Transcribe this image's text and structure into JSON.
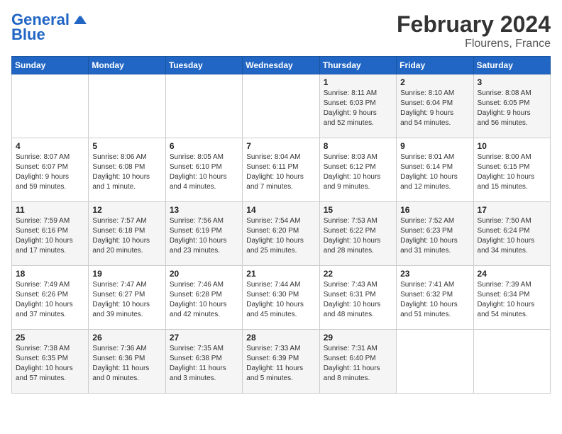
{
  "header": {
    "logo_line1": "General",
    "logo_line2": "Blue",
    "month": "February 2024",
    "location": "Flourens, France"
  },
  "days_of_week": [
    "Sunday",
    "Monday",
    "Tuesday",
    "Wednesday",
    "Thursday",
    "Friday",
    "Saturday"
  ],
  "weeks": [
    [
      {
        "day": "",
        "info": ""
      },
      {
        "day": "",
        "info": ""
      },
      {
        "day": "",
        "info": ""
      },
      {
        "day": "",
        "info": ""
      },
      {
        "day": "1",
        "info": "Sunrise: 8:11 AM\nSunset: 6:03 PM\nDaylight: 9 hours\nand 52 minutes."
      },
      {
        "day": "2",
        "info": "Sunrise: 8:10 AM\nSunset: 6:04 PM\nDaylight: 9 hours\nand 54 minutes."
      },
      {
        "day": "3",
        "info": "Sunrise: 8:08 AM\nSunset: 6:05 PM\nDaylight: 9 hours\nand 56 minutes."
      }
    ],
    [
      {
        "day": "4",
        "info": "Sunrise: 8:07 AM\nSunset: 6:07 PM\nDaylight: 9 hours\nand 59 minutes."
      },
      {
        "day": "5",
        "info": "Sunrise: 8:06 AM\nSunset: 6:08 PM\nDaylight: 10 hours\nand 1 minute."
      },
      {
        "day": "6",
        "info": "Sunrise: 8:05 AM\nSunset: 6:10 PM\nDaylight: 10 hours\nand 4 minutes."
      },
      {
        "day": "7",
        "info": "Sunrise: 8:04 AM\nSunset: 6:11 PM\nDaylight: 10 hours\nand 7 minutes."
      },
      {
        "day": "8",
        "info": "Sunrise: 8:03 AM\nSunset: 6:12 PM\nDaylight: 10 hours\nand 9 minutes."
      },
      {
        "day": "9",
        "info": "Sunrise: 8:01 AM\nSunset: 6:14 PM\nDaylight: 10 hours\nand 12 minutes."
      },
      {
        "day": "10",
        "info": "Sunrise: 8:00 AM\nSunset: 6:15 PM\nDaylight: 10 hours\nand 15 minutes."
      }
    ],
    [
      {
        "day": "11",
        "info": "Sunrise: 7:59 AM\nSunset: 6:16 PM\nDaylight: 10 hours\nand 17 minutes."
      },
      {
        "day": "12",
        "info": "Sunrise: 7:57 AM\nSunset: 6:18 PM\nDaylight: 10 hours\nand 20 minutes."
      },
      {
        "day": "13",
        "info": "Sunrise: 7:56 AM\nSunset: 6:19 PM\nDaylight: 10 hours\nand 23 minutes."
      },
      {
        "day": "14",
        "info": "Sunrise: 7:54 AM\nSunset: 6:20 PM\nDaylight: 10 hours\nand 25 minutes."
      },
      {
        "day": "15",
        "info": "Sunrise: 7:53 AM\nSunset: 6:22 PM\nDaylight: 10 hours\nand 28 minutes."
      },
      {
        "day": "16",
        "info": "Sunrise: 7:52 AM\nSunset: 6:23 PM\nDaylight: 10 hours\nand 31 minutes."
      },
      {
        "day": "17",
        "info": "Sunrise: 7:50 AM\nSunset: 6:24 PM\nDaylight: 10 hours\nand 34 minutes."
      }
    ],
    [
      {
        "day": "18",
        "info": "Sunrise: 7:49 AM\nSunset: 6:26 PM\nDaylight: 10 hours\nand 37 minutes."
      },
      {
        "day": "19",
        "info": "Sunrise: 7:47 AM\nSunset: 6:27 PM\nDaylight: 10 hours\nand 39 minutes."
      },
      {
        "day": "20",
        "info": "Sunrise: 7:46 AM\nSunset: 6:28 PM\nDaylight: 10 hours\nand 42 minutes."
      },
      {
        "day": "21",
        "info": "Sunrise: 7:44 AM\nSunset: 6:30 PM\nDaylight: 10 hours\nand 45 minutes."
      },
      {
        "day": "22",
        "info": "Sunrise: 7:43 AM\nSunset: 6:31 PM\nDaylight: 10 hours\nand 48 minutes."
      },
      {
        "day": "23",
        "info": "Sunrise: 7:41 AM\nSunset: 6:32 PM\nDaylight: 10 hours\nand 51 minutes."
      },
      {
        "day": "24",
        "info": "Sunrise: 7:39 AM\nSunset: 6:34 PM\nDaylight: 10 hours\nand 54 minutes."
      }
    ],
    [
      {
        "day": "25",
        "info": "Sunrise: 7:38 AM\nSunset: 6:35 PM\nDaylight: 10 hours\nand 57 minutes."
      },
      {
        "day": "26",
        "info": "Sunrise: 7:36 AM\nSunset: 6:36 PM\nDaylight: 11 hours\nand 0 minutes."
      },
      {
        "day": "27",
        "info": "Sunrise: 7:35 AM\nSunset: 6:38 PM\nDaylight: 11 hours\nand 3 minutes."
      },
      {
        "day": "28",
        "info": "Sunrise: 7:33 AM\nSunset: 6:39 PM\nDaylight: 11 hours\nand 5 minutes."
      },
      {
        "day": "29",
        "info": "Sunrise: 7:31 AM\nSunset: 6:40 PM\nDaylight: 11 hours\nand 8 minutes."
      },
      {
        "day": "",
        "info": ""
      },
      {
        "day": "",
        "info": ""
      }
    ]
  ]
}
